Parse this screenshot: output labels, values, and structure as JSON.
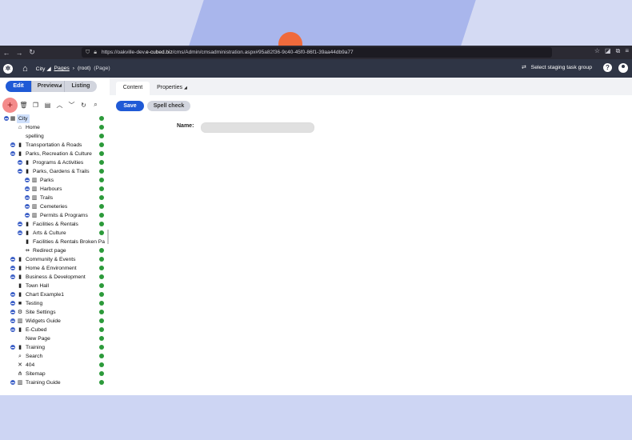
{
  "browser": {
    "url_prefix": "https://oakville-dev.",
    "url_domain": "e-cubed.biz",
    "url_rest": "/cms/Admin/cmsadministration.aspx#95a82f36-9c40-45f0-86f1-39aa44db9a77"
  },
  "header": {
    "site": "City",
    "crumb_pages": "Pages",
    "crumb_root": "(root)",
    "crumb_type": "(Page)",
    "staging": "Select staging task group",
    "help": "?"
  },
  "modes": [
    {
      "label": "Edit"
    },
    {
      "label": "Preview"
    },
    {
      "label": "Listing"
    }
  ],
  "tree": [
    {
      "label": "City"
    },
    {
      "label": "Home"
    },
    {
      "label": "spelling"
    },
    {
      "label": "Transportation & Roads"
    },
    {
      "label": "Parks, Recreation & Culture"
    },
    {
      "label": "Programs & Activities"
    },
    {
      "label": "Parks, Gardens & Trails"
    },
    {
      "label": "Parks"
    },
    {
      "label": "Harbours"
    },
    {
      "label": "Trails"
    },
    {
      "label": "Cemeteries"
    },
    {
      "label": "Permits & Programs"
    },
    {
      "label": "Facilities & Rentals"
    },
    {
      "label": "Arts & Culture"
    },
    {
      "label": "Facilities & Rentals Broken Pa"
    },
    {
      "label": "Redirect page"
    },
    {
      "label": "Community & Events"
    },
    {
      "label": "Home & Environment"
    },
    {
      "label": "Business & Development"
    },
    {
      "label": "Town Hall"
    },
    {
      "label": "Chart Example1"
    },
    {
      "label": "Testing"
    },
    {
      "label": "Site Settings"
    },
    {
      "label": "Widgets Guide"
    },
    {
      "label": "E-Cubed"
    },
    {
      "label": "New Page"
    },
    {
      "label": "Training"
    },
    {
      "label": "Search"
    },
    {
      "label": "404"
    },
    {
      "label": "Sitemap"
    },
    {
      "label": "Training Guide"
    }
  ],
  "tabs": {
    "content": "Content",
    "properties": "Properties"
  },
  "buttons": {
    "save": "Save",
    "spell": "Spell check"
  },
  "form": {
    "name_label": "Name:",
    "name_value": ""
  }
}
